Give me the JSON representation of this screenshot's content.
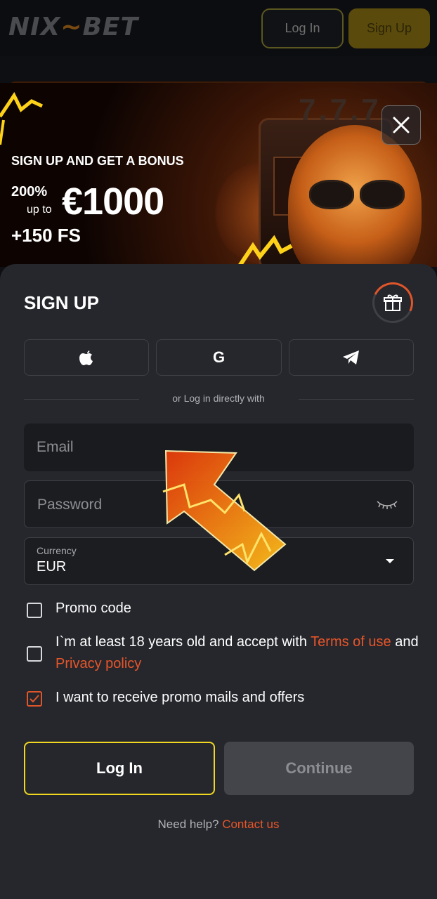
{
  "header": {
    "logo_part1": "NIX",
    "logo_part2": "BET",
    "login_label": "Log In",
    "signup_label": "Sign Up"
  },
  "banner": {
    "title": "SIGN UP AND GET A BONUS",
    "percent": "200%",
    "up_to": "up to",
    "amount": "€1000",
    "free_spins": "+150 FS",
    "close_icon": "close-icon"
  },
  "signup": {
    "title": "SIGN UP",
    "gift_icon": "gift-icon",
    "social_buttons": [
      {
        "icon": "apple-icon"
      },
      {
        "icon": "google-icon",
        "glyph": "G"
      },
      {
        "icon": "telegram-icon"
      }
    ],
    "divider_text": "or Log in directly with",
    "email_placeholder": "Email",
    "password_placeholder": "Password",
    "currency_label": "Currency",
    "currency_value": "EUR",
    "promo_code_label": "Promo code",
    "age_text": "I`m at least 18 years old and accept with ",
    "terms_link": "Terms of use",
    "and_text": " and ",
    "privacy_link": "Privacy policy",
    "promo_mails_label": "I want to receive promo mails and offers",
    "promo_code_checked": false,
    "age_checked": false,
    "promo_mails_checked": true,
    "login_button": "Log In",
    "continue_button": "Continue",
    "help_text": "Need help? ",
    "contact_link": "Contact us"
  },
  "colors": {
    "accent_orange": "#e8552a",
    "accent_yellow": "#f0d722",
    "panel_bg": "#25272c"
  }
}
